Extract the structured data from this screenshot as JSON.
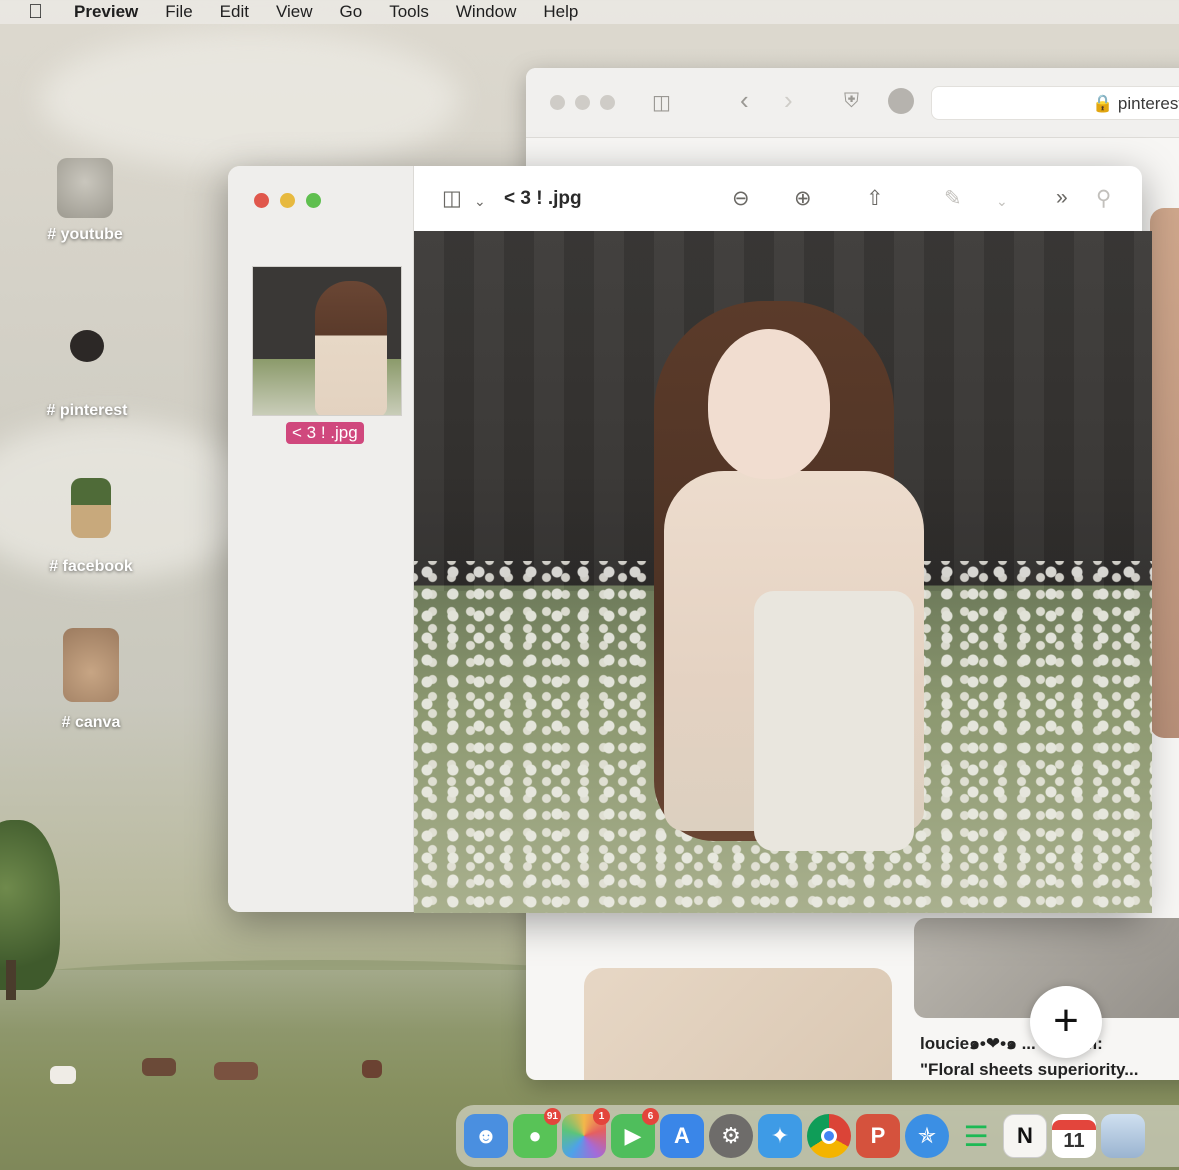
{
  "menubar": {
    "app": "Preview",
    "items": [
      "File",
      "Edit",
      "View",
      "Go",
      "Tools",
      "Window",
      "Help"
    ]
  },
  "desktop_icons": [
    {
      "label": "# youtube",
      "icon": "cat-plush-icon"
    },
    {
      "label": "# pinterest",
      "icon": "flower-icon"
    },
    {
      "label": "# facebook",
      "icon": "vase-icon"
    },
    {
      "label": "# canva",
      "icon": "bunny-plush-icon"
    }
  ],
  "safari": {
    "url": "pinterest",
    "caption_user": "loucie๑•❤•๑ ... tagram:",
    "caption_text": "\"Floral sheets superiority...",
    "add_button": "+"
  },
  "preview": {
    "title": "< 3 ! .jpg",
    "thumbnail_label": "< 3 ! .jpg",
    "toolbar_icons": [
      "sidebar-icon",
      "zoom-out-icon",
      "zoom-in-icon",
      "share-icon",
      "markup-icon",
      "more-icon",
      "search-icon"
    ]
  },
  "dock": {
    "apps": [
      {
        "name": "Finder",
        "color": "#4a8fe0",
        "badge": ""
      },
      {
        "name": "Messages",
        "color": "#58c357",
        "badge": "91"
      },
      {
        "name": "Photos",
        "color": "#f2b84a",
        "badge": "1"
      },
      {
        "name": "FaceTime",
        "color": "#4fbe5c",
        "badge": "6"
      },
      {
        "name": "App Store",
        "color": "#3a86e8",
        "badge": ""
      },
      {
        "name": "System Settings",
        "color": "#6e6c6a",
        "badge": ""
      },
      {
        "name": "Twitter",
        "color": "#3e9be6",
        "badge": ""
      },
      {
        "name": "Chrome",
        "color": "#e8e6e2",
        "badge": ""
      },
      {
        "name": "Pinterest",
        "color": "#d5523d",
        "badge": ""
      },
      {
        "name": "Safari",
        "color": "#3b8fe4",
        "badge": ""
      },
      {
        "name": "Spotify",
        "color": "#1f1f1f",
        "badge": ""
      },
      {
        "name": "Notion",
        "color": "#f6f5f2",
        "badge": ""
      },
      {
        "name": "Calendar",
        "color": "#ffffff",
        "badge": ""
      },
      {
        "name": "Preview",
        "color": "#9ab4d0",
        "badge": ""
      }
    ],
    "calendar_day": "11"
  },
  "colors": {
    "accent_pink": "#d0487d",
    "close": "#e0574c",
    "minimize": "#e7b93f",
    "zoom": "#5fbf4f"
  }
}
